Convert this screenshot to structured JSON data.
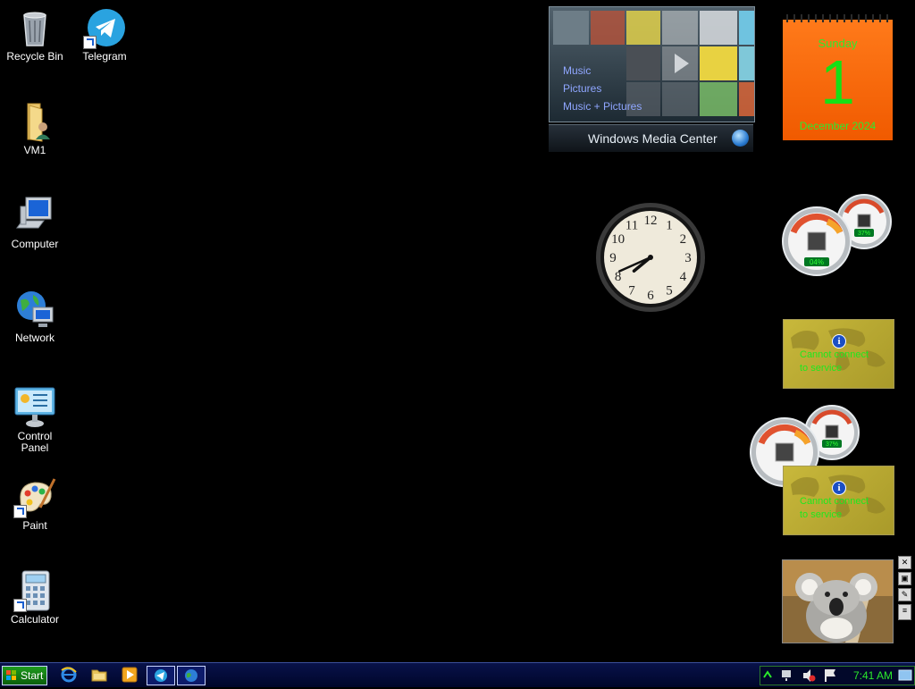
{
  "desktop": {
    "icons": [
      {
        "label": "Recycle Bin",
        "icon": "recycle-bin-icon"
      },
      {
        "label": "Telegram",
        "icon": "telegram-icon"
      },
      {
        "label": "VM1",
        "icon": "user-folder-icon"
      },
      {
        "label": "Computer",
        "icon": "computer-icon"
      },
      {
        "label": "Network",
        "icon": "network-icon"
      },
      {
        "label": "Control Panel",
        "icon": "control-panel-icon"
      },
      {
        "label": "Paint",
        "icon": "paint-icon"
      },
      {
        "label": "Calculator",
        "icon": "calculator-icon"
      }
    ]
  },
  "gadgets": {
    "media_center": {
      "menu": [
        "Music",
        "Pictures",
        "Music + Pictures"
      ],
      "title": "Windows Media Center"
    },
    "calendar": {
      "weekday": "Sunday",
      "day": "1",
      "month_year": "December 2024"
    },
    "clock": {
      "hour": 7,
      "minute": 41,
      "numerals": [
        "12",
        "1",
        "2",
        "3",
        "4",
        "5",
        "6",
        "7",
        "8",
        "9",
        "10",
        "11"
      ]
    },
    "cpu_meter_1": {
      "cpu_percent": "04%",
      "ram_percent": "37%"
    },
    "cpu_meter_2": {
      "cpu_percent": "",
      "ram_percent": "37%"
    },
    "currency_1": {
      "message_line1": "Cannot connect",
      "message_line2": "to service"
    },
    "currency_2": {
      "message_line1": "Cannot connect",
      "message_line2": "to service"
    }
  },
  "taskbar": {
    "start_label": "Start",
    "time": "7:41 AM",
    "accent": "#2bea2b"
  }
}
